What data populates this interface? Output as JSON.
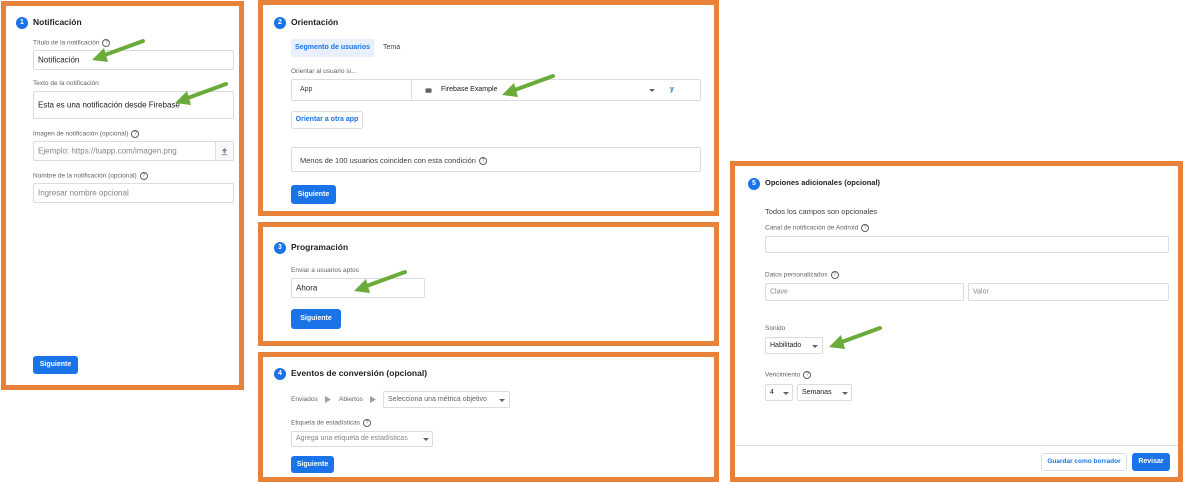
{
  "notification": {
    "step": "1",
    "title": "Notificación",
    "title_field_label": "Título de la notificación",
    "title_field_value": "Notificación",
    "text_field_label": "Texto de la notificación",
    "text_field_value": "Esta es una notificación desde Firebase",
    "image_label": "Imagen de notificación (opcional)",
    "image_placeholder": "Ejemplo: https://tuapp.com/imagen.png",
    "name_label": "Nombre de la notificación (opcional)",
    "name_placeholder": "Ingresar nombre opcional",
    "next_label": "Siguiente"
  },
  "targeting": {
    "step": "2",
    "title": "Orientación",
    "tab_segment": "Segmento de usuarios",
    "tab_topic": "Tema",
    "target_label": "Orientar al usuario si...",
    "app_label": "App",
    "app_value": "Firebase Example",
    "and_label": "y",
    "other_app_label": "Orientar a otra app",
    "match_text": "Menos de 100 usuarios coinciden con esta condición",
    "next_label": "Siguiente"
  },
  "scheduling": {
    "step": "3",
    "title": "Programación",
    "send_label": "Enviar a usuarios aptos",
    "send_value": "Ahora",
    "next_label": "Siguiente"
  },
  "conversion": {
    "step": "4",
    "title": "Eventos de conversión (opcional)",
    "sent_label": "Enviados",
    "opened_label": "Abiertos",
    "metric_placeholder": "Selecciona una métrica objetivo",
    "analytics_label": "Etiqueta de estadísticas",
    "analytics_placeholder": "Agrega una etiqueta de estadísticas",
    "next_label": "Siguiente"
  },
  "options": {
    "step": "5",
    "title": "Opciones adicionales (opcional)",
    "all_optional": "Todos los campos son opcionales",
    "android_channel_label": "Canal de notificación de Android",
    "custom_data_label": "Datos personalizados",
    "key_placeholder": "Clave",
    "value_placeholder": "Valor",
    "sound_label": "Sonido",
    "sound_value": "Habilitado",
    "expiry_label": "Vencimiento",
    "expiry_number": "4",
    "expiry_unit": "Semanas",
    "save_draft_label": "Guardar como borrador",
    "review_label": "Revisar"
  },
  "colors": {
    "highlight_border": "#e8823a",
    "primary": "#1a73e8",
    "arrow": "#6aab3a"
  },
  "icons": [
    "upload-icon",
    "help-icon",
    "app-icon",
    "chevron-down-icon",
    "arrow-right-icon",
    "green-arrow-annotation"
  ]
}
